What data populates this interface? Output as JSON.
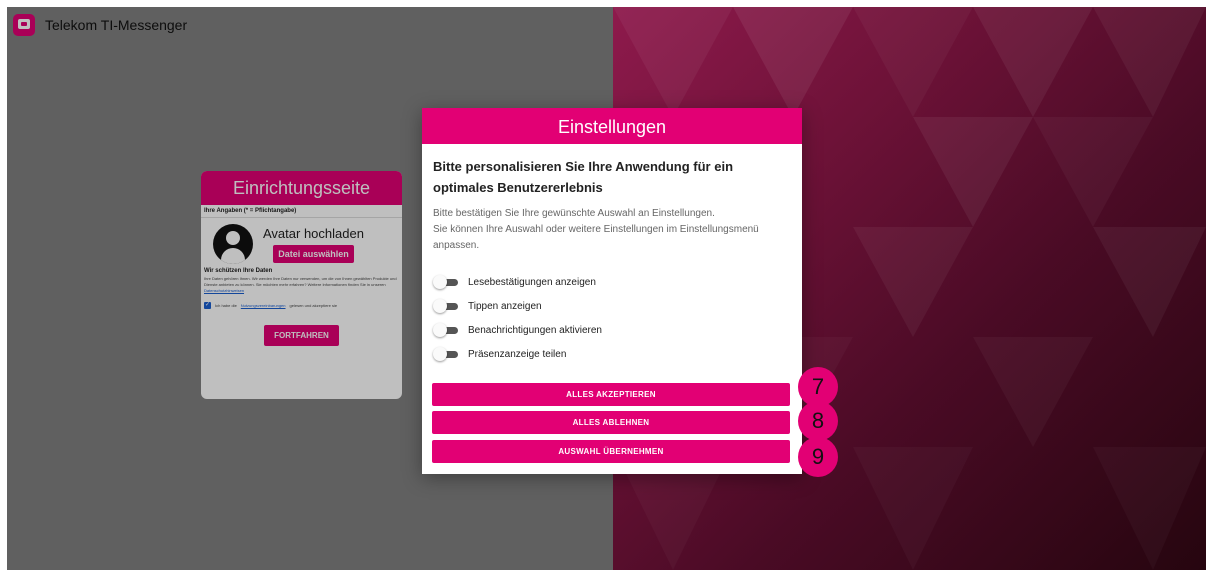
{
  "app": {
    "title": "Telekom TI-Messenger"
  },
  "setup": {
    "title": "Einrichtungsseite",
    "subtitle": "Ihre Angaben (* = Pflichtangabe)",
    "avatar_title": "Avatar hochladen",
    "file_button": "Datei auswählen",
    "protect_title": "Wir schützen Ihre Daten",
    "protect_text": "Ihre Daten gehören Ihnen. Wir werden Ihre Daten nur verwenden, um die von Ihnen gewählten Produkte und Dienste anbieten zu können. Sie möchten mehr erfahren? Weitere Informationen finden Sie in unseren",
    "protect_link": "Datenschutzhinweisen",
    "consent_prefix": "Ich habe die",
    "consent_link": "Nutzungsvereinbarungen",
    "consent_suffix": "gelesen und akzeptiere sie",
    "continue_button": "FORTFAHREN"
  },
  "dialog": {
    "title": "Einstellungen",
    "heading": "Bitte personalisieren Sie Ihre Anwendung für ein optimales Benutzererlebnis",
    "desc_line1": "Bitte bestätigen Sie Ihre gewünschte Auswahl an Einstellungen.",
    "desc_line2": "Sie können Ihre Auswahl oder weitere Einstellungen im Einstellungsmenü anpassen.",
    "toggles": [
      {
        "label": "Lesebestätigungen anzeigen"
      },
      {
        "label": "Tippen anzeigen"
      },
      {
        "label": "Benachrichtigungen aktivieren"
      },
      {
        "label": "Präsenzanzeige teilen"
      }
    ],
    "accept_button": "ALLES AKZEPTIEREN",
    "reject_button": "ALLES ABLEHNEN",
    "apply_button": "AUSWAHL ÜBERNEHMEN"
  },
  "badges": [
    "7",
    "8",
    "9"
  ],
  "colors": {
    "accent": "#e20074"
  }
}
